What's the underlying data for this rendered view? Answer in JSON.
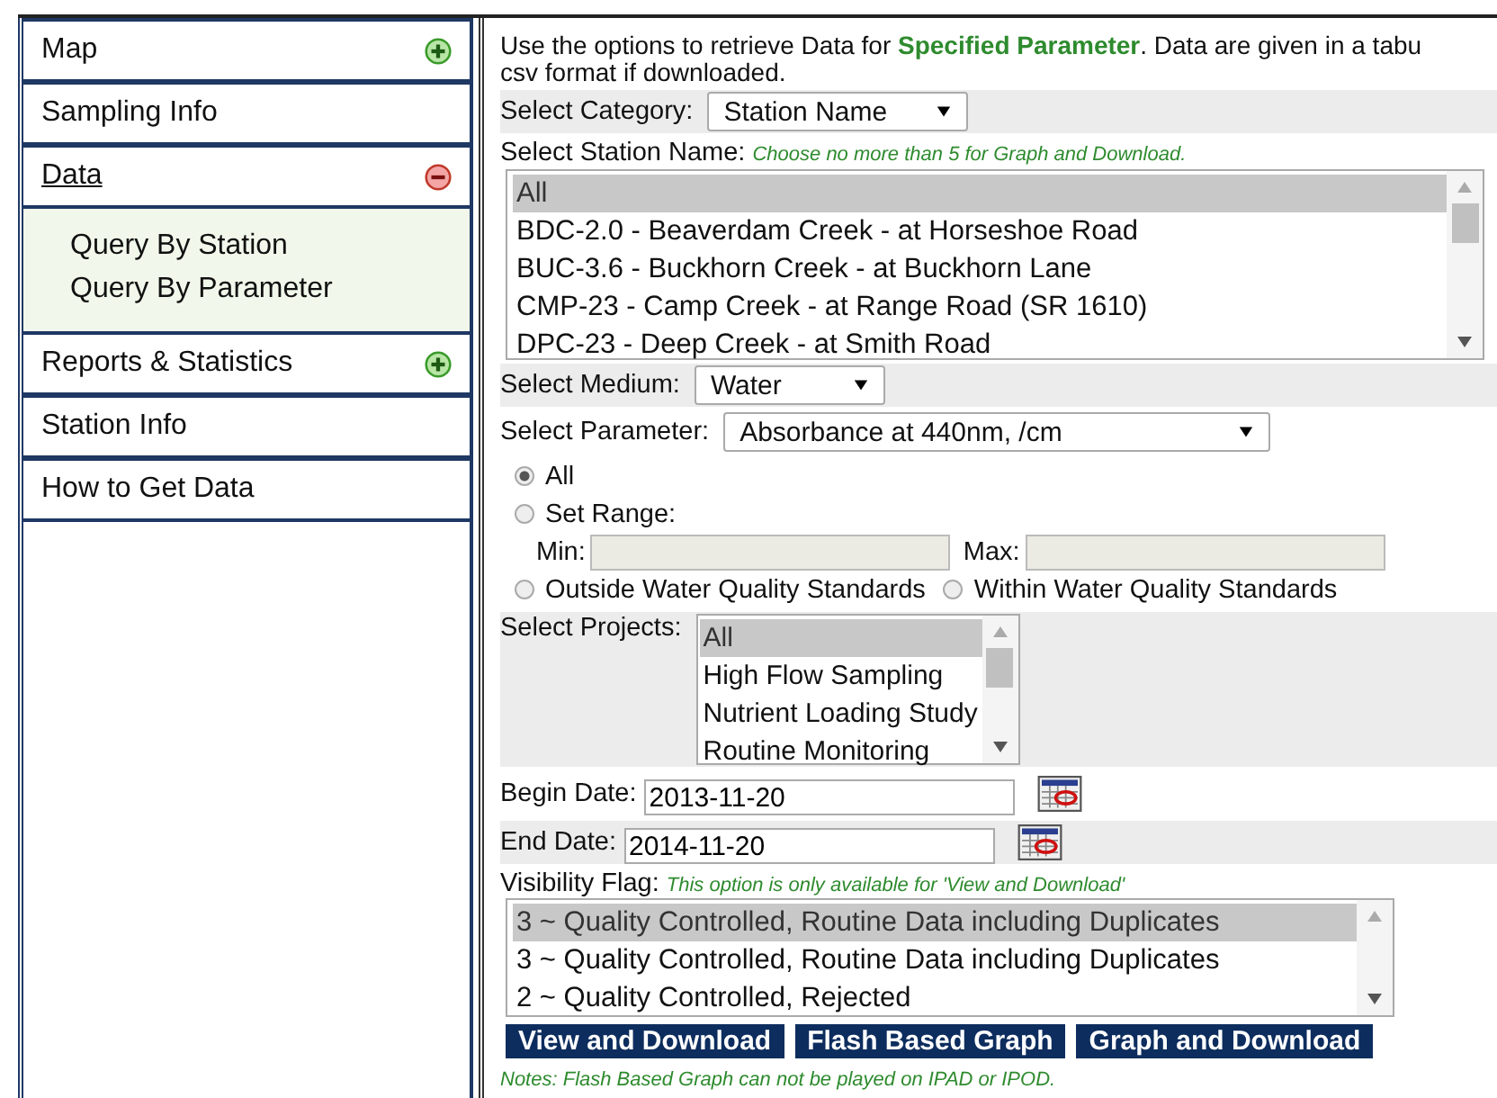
{
  "sidebar": {
    "items": [
      {
        "label": "Map",
        "kind": "group",
        "expanded": false,
        "selected": false
      },
      {
        "label": "Sampling Info",
        "kind": "link",
        "selected": false
      },
      {
        "label": "Data",
        "kind": "group",
        "expanded": true,
        "selected": true,
        "children": [
          {
            "label": "Query By Station"
          },
          {
            "label": "Query By Parameter"
          }
        ]
      },
      {
        "label": "Reports & Statistics",
        "kind": "group",
        "expanded": false,
        "selected": false
      },
      {
        "label": "Station Info",
        "kind": "link",
        "selected": false
      },
      {
        "label": "How to Get Data",
        "kind": "link",
        "selected": false
      }
    ]
  },
  "intro": {
    "lines": [
      "Use the options to retrieve Data for **Specified Parameter**. Data are given in a tabu",
      "csv format if downloaded."
    ]
  },
  "category": {
    "label": "Select Category:",
    "value": "Station Name"
  },
  "station": {
    "label": "Select Station Name:",
    "hint": "Choose no more than 5 for Graph and Download.",
    "options": [
      {
        "label": "All",
        "selected": true
      },
      {
        "label": "BDC-2.0 - Beaverdam Creek - at Horseshoe Road",
        "selected": false
      },
      {
        "label": "BUC-3.6 - Buckhorn Creek - at Buckhorn Lane",
        "selected": false
      },
      {
        "label": "CMP-23 - Camp Creek - at Range Road (SR 1610)",
        "selected": false
      },
      {
        "label": "DPC-23 - Deep Creek - at Smith Road",
        "selected": false
      }
    ]
  },
  "medium": {
    "label": "Select Medium:",
    "value": "Water"
  },
  "parameter": {
    "label": "Select Parameter:",
    "value": "Absorbance at 440nm, /cm"
  },
  "range_mode": [
    {
      "label": "All",
      "selected": true
    },
    {
      "label": "Set Range:",
      "selected": false
    }
  ],
  "min": {
    "label": "Min:"
  },
  "max": {
    "label": "Max:"
  },
  "standards": [
    {
      "label": "Outside Water Quality Standards",
      "selected": false
    },
    {
      "label": "Within Water Quality Standards",
      "selected": false
    }
  ],
  "projects": {
    "label": "Select Projects:",
    "options": [
      {
        "label": "All",
        "selected": true
      },
      {
        "label": "High Flow Sampling",
        "selected": false
      },
      {
        "label": "Nutrient Loading Study",
        "selected": false
      },
      {
        "label": "Routine Monitoring",
        "selected": false
      }
    ]
  },
  "begin_date": {
    "label": "Begin Date:",
    "value": "2013-11-20"
  },
  "end_date": {
    "label": "End Date:",
    "value": "2014-11-20"
  },
  "visibility": {
    "label": "Visibility Flag:",
    "hint": "This option is only available for 'View and Download'",
    "options": [
      {
        "label": "3 ~ Quality Controlled, Routine Data including Duplicates",
        "selected": true
      },
      {
        "label": "3 ~ Quality Controlled, Routine Data including Duplicates",
        "selected": false
      },
      {
        "label": "2 ~ Quality Controlled, Rejected",
        "selected": false
      }
    ]
  },
  "buttons": [
    "View and Download",
    "Flash Based Graph",
    "Graph and Download"
  ],
  "note": "Notes: Flash Based Graph can not be played on IPAD or IPOD."
}
